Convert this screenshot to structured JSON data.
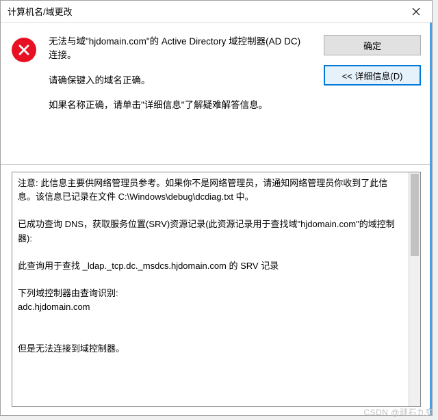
{
  "title": "计算机名/域更改",
  "error": {
    "line1": "无法与域\"hjdomain.com\"的 Active Directory 域控制器(AD DC)连接。",
    "line2": "请确保键入的域名正确。",
    "line3": "如果名称正确，请单击\"详细信息\"了解疑难解答信息。"
  },
  "buttons": {
    "ok": "确定",
    "details": "<< 详细信息(D)"
  },
  "details_text": "注意: 此信息主要供网络管理员参考。如果你不是网络管理员，请通知网络管理员你收到了此信息。该信息已记录在文件 C:\\Windows\\debug\\dcdiag.txt 中。\n\n已成功查询 DNS，获取服务位置(SRV)资源记录(此资源记录用于查找域\"hjdomain.com\"的域控制器):\n\n此查询用于查找 _ldap._tcp.dc._msdcs.hjdomain.com 的 SRV 记录\n\n下列域控制器由查询识别:\nadc.hjdomain.com\n\n\n但是无法连接到域控制器。",
  "watermark": "CSDN @顽石九变"
}
